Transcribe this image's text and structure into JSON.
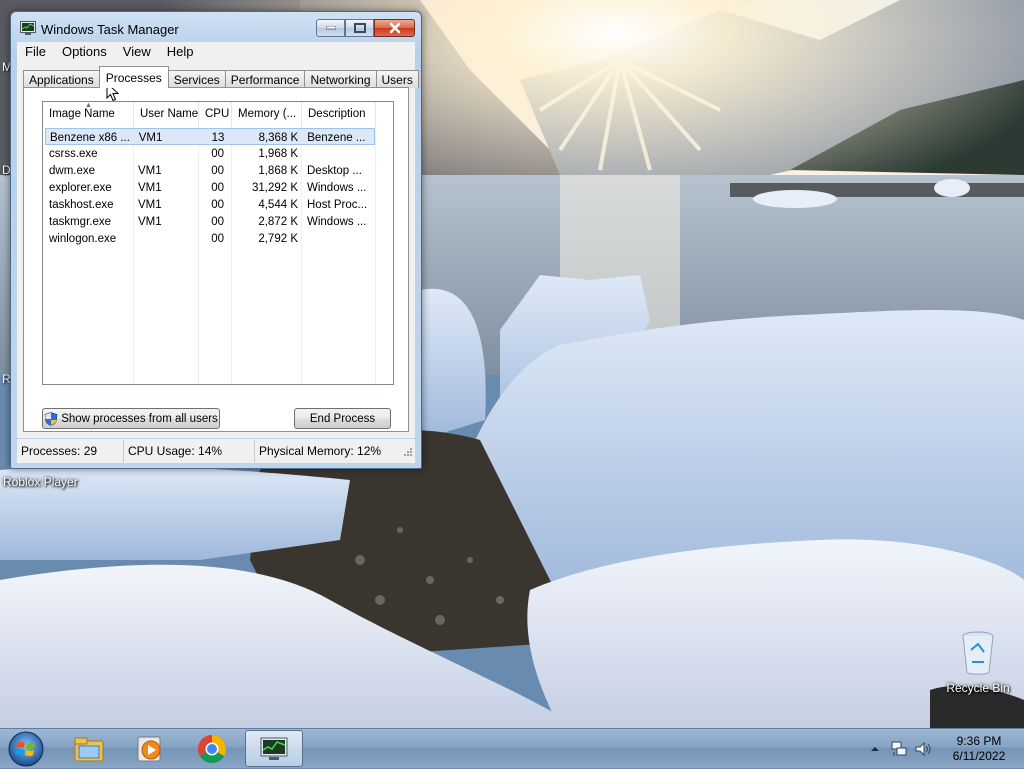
{
  "window": {
    "title": "Windows Task Manager"
  },
  "menu": [
    "File",
    "Options",
    "View",
    "Help"
  ],
  "tabs": [
    {
      "label": "Applications"
    },
    {
      "label": "Processes"
    },
    {
      "label": "Services"
    },
    {
      "label": "Performance"
    },
    {
      "label": "Networking"
    },
    {
      "label": "Users"
    }
  ],
  "processes": {
    "columns": [
      "Image Name",
      "User Name",
      "CPU",
      "Memory (...",
      "Description"
    ],
    "rows": [
      {
        "name": "Benzene x86 ...",
        "user": "VM1",
        "cpu": "13",
        "memory": "8,368 K",
        "desc": "Benzene ..."
      },
      {
        "name": "csrss.exe",
        "user": "",
        "cpu": "00",
        "memory": "1,968 K",
        "desc": ""
      },
      {
        "name": "dwm.exe",
        "user": "VM1",
        "cpu": "00",
        "memory": "1,868 K",
        "desc": "Desktop ..."
      },
      {
        "name": "explorer.exe",
        "user": "VM1",
        "cpu": "00",
        "memory": "31,292 K",
        "desc": "Windows ..."
      },
      {
        "name": "taskhost.exe",
        "user": "VM1",
        "cpu": "00",
        "memory": "4,544 K",
        "desc": "Host Proc..."
      },
      {
        "name": "taskmgr.exe",
        "user": "VM1",
        "cpu": "00",
        "memory": "2,872 K",
        "desc": "Windows ..."
      },
      {
        "name": "winlogon.exe",
        "user": "",
        "cpu": "00",
        "memory": "2,792 K",
        "desc": ""
      }
    ],
    "show_all_label": "Show processes from all users",
    "end_process_label": "End Process"
  },
  "status": {
    "processes": "Processes: 29",
    "cpu": "CPU Usage: 14%",
    "memory": "Physical Memory: 12%"
  },
  "desktop": {
    "icons": [
      {
        "label": "Roblox Player"
      },
      {
        "label": "Recycle Bin"
      }
    ],
    "edge_fragments": [
      "M",
      "D",
      "R"
    ]
  },
  "taskbar": {
    "items": [
      "windows-explorer-icon",
      "media-player-icon",
      "chrome-icon",
      "task-manager-icon"
    ],
    "clock_time": "9:36 PM",
    "clock_date": "6/11/2022"
  }
}
